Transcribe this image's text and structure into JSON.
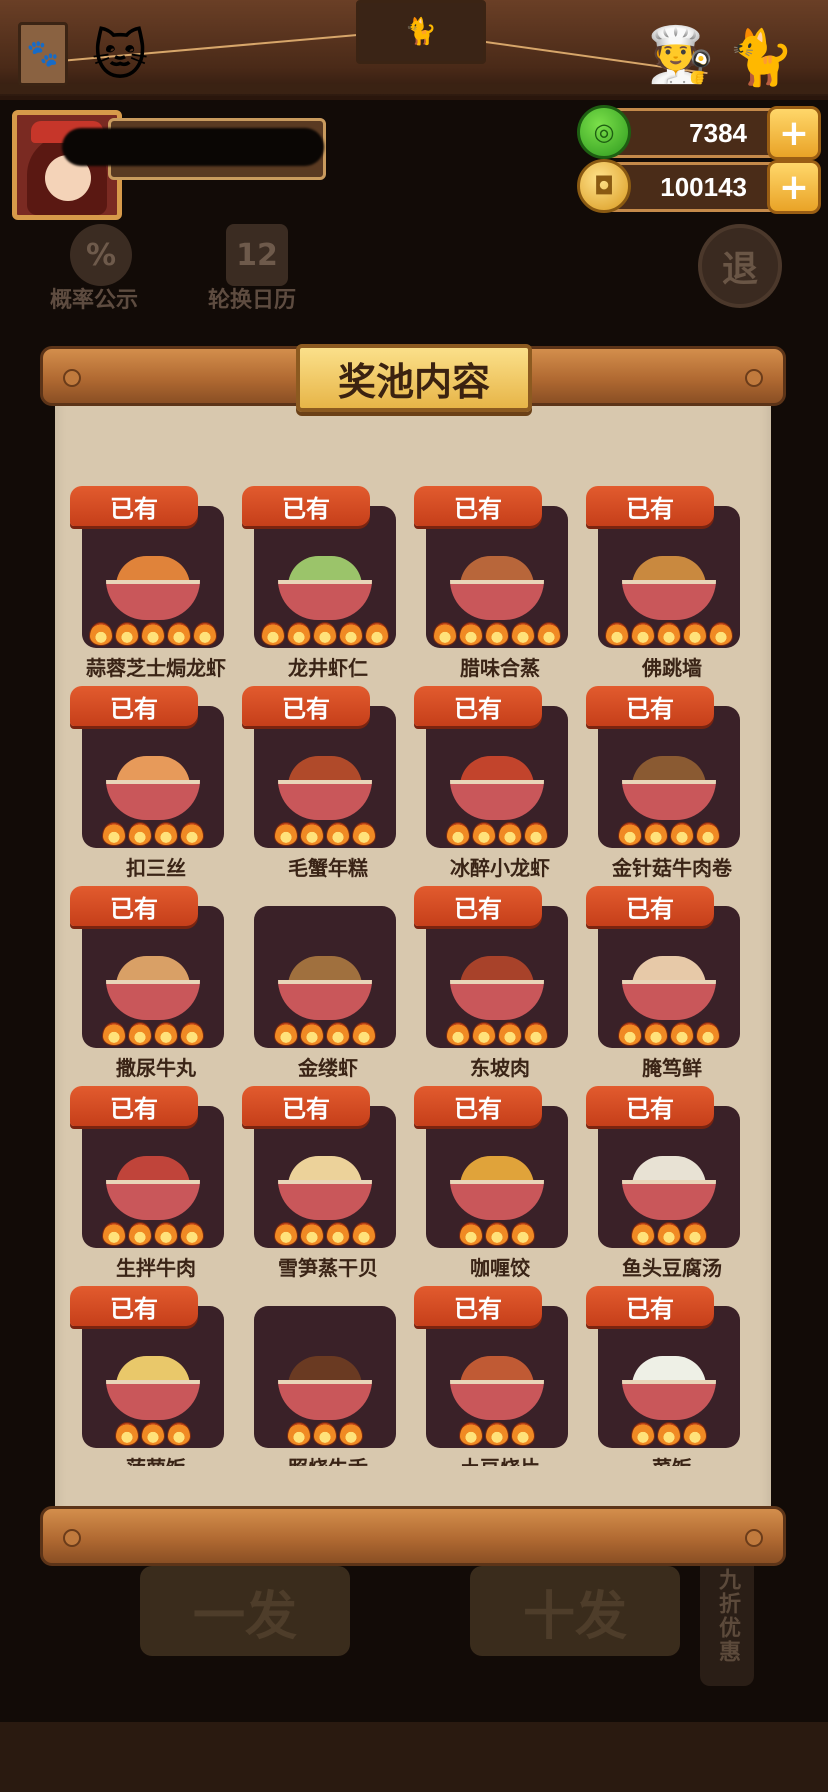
{
  "header": {
    "currencies": [
      {
        "name": "jade",
        "value": "7384",
        "icon": "jade-coin-icon",
        "color": "#3fae2a"
      },
      {
        "name": "gold",
        "value": "100143",
        "icon": "gold-coin-icon",
        "color": "#e8b234"
      }
    ],
    "plus_glyph": "+"
  },
  "background": {
    "probability_label": "概率公示",
    "probability_icon_glyph": "%",
    "calendar_label": "轮换日历",
    "calendar_icon_glyph": "12",
    "exit_label": "退",
    "draw_once_label": "一发",
    "draw_ten_label": "十发",
    "discount_label": "九折优惠"
  },
  "dialog": {
    "title": "奖池内容",
    "owned_label": "已有",
    "items": [
      {
        "name": "蒜蓉芝士焗龙虾",
        "owned": true,
        "stars": 5,
        "color": "#e0833a"
      },
      {
        "name": "龙井虾仁",
        "owned": true,
        "stars": 5,
        "color": "#9bc46a"
      },
      {
        "name": "腊味合蒸",
        "owned": true,
        "stars": 5,
        "color": "#b8663a"
      },
      {
        "name": "佛跳墙",
        "owned": true,
        "stars": 5,
        "color": "#c9893f"
      },
      {
        "name": "扣三丝",
        "owned": true,
        "stars": 4,
        "color": "#e79a5a"
      },
      {
        "name": "毛蟹年糕",
        "owned": true,
        "stars": 4,
        "color": "#b04a2a"
      },
      {
        "name": "冰醉小龙虾",
        "owned": true,
        "stars": 4,
        "color": "#c2442c"
      },
      {
        "name": "金针菇牛肉卷",
        "owned": true,
        "stars": 4,
        "color": "#8a5a32"
      },
      {
        "name": "撒尿牛丸",
        "owned": true,
        "stars": 4,
        "color": "#d9a066"
      },
      {
        "name": "金缕虾",
        "owned": false,
        "stars": 4,
        "color": "#a0703e"
      },
      {
        "name": "东坡肉",
        "owned": true,
        "stars": 4,
        "color": "#a8422a"
      },
      {
        "name": "腌笃鲜",
        "owned": true,
        "stars": 4,
        "color": "#e7c9a8"
      },
      {
        "name": "生拌牛肉",
        "owned": true,
        "stars": 4,
        "color": "#c0443a"
      },
      {
        "name": "雪笋蒸干贝",
        "owned": true,
        "stars": 4,
        "color": "#ecd29a"
      },
      {
        "name": "咖喱饺",
        "owned": true,
        "stars": 3,
        "color": "#e0a33a"
      },
      {
        "name": "鱼头豆腐汤",
        "owned": true,
        "stars": 3,
        "color": "#e8e2d4"
      },
      {
        "name": "菠萝饭",
        "owned": true,
        "stars": 3,
        "color": "#e9c86a"
      },
      {
        "name": "照烧牛舌",
        "owned": false,
        "stars": 3,
        "color": "#6a3a22"
      },
      {
        "name": "土豆烧片",
        "owned": true,
        "stars": 3,
        "color": "#c05a34"
      },
      {
        "name": "菜饭",
        "owned": true,
        "stars": 3,
        "color": "#eef0e6"
      }
    ]
  }
}
